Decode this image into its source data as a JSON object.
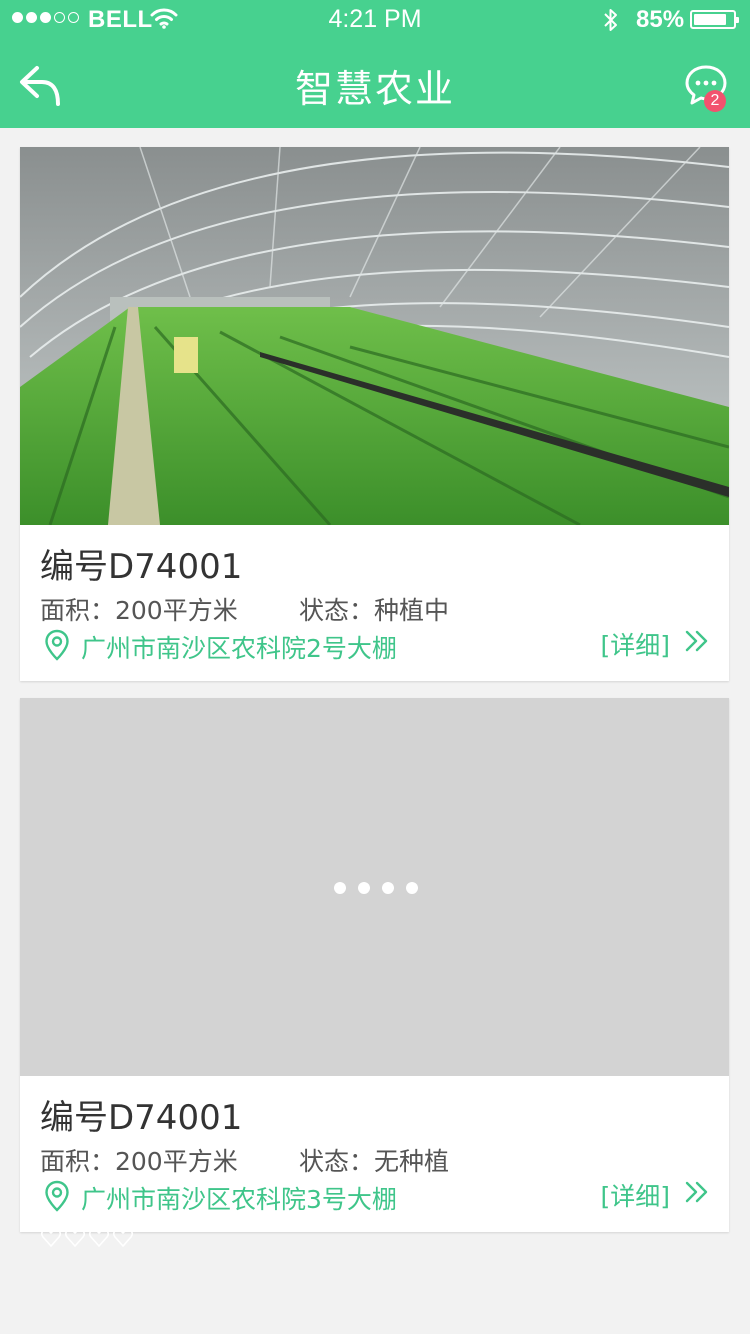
{
  "status_bar": {
    "carrier": "BELL",
    "time": "4:21 PM",
    "battery_pct": "85%",
    "signal_bars_filled": 3,
    "signal_bars_total": 5
  },
  "nav": {
    "title": "智慧农业",
    "back_icon": "back-arrow-icon",
    "message_icon": "chat-bubble-icon",
    "message_badge": "2"
  },
  "colors": {
    "brand": "#47d18f",
    "accent_text": "#3fc58a",
    "badge": "#f2526e",
    "placeholder": "#d3d3d3"
  },
  "greenhouses": [
    {
      "id_label": "编号D74001",
      "area_label": "面积：200平方米",
      "status_label": "状态：种植中",
      "address": "广州市南沙区农科院2号大棚",
      "detail_label": "[详细]",
      "image": "greenhouse-photo"
    },
    {
      "id_label": "编号D74001",
      "area_label": "面积：200平方米",
      "status_label": "状态：无种植",
      "address": "广州市南沙区农科院3号大棚",
      "detail_label": "[详细]",
      "image": "loading-placeholder"
    }
  ]
}
